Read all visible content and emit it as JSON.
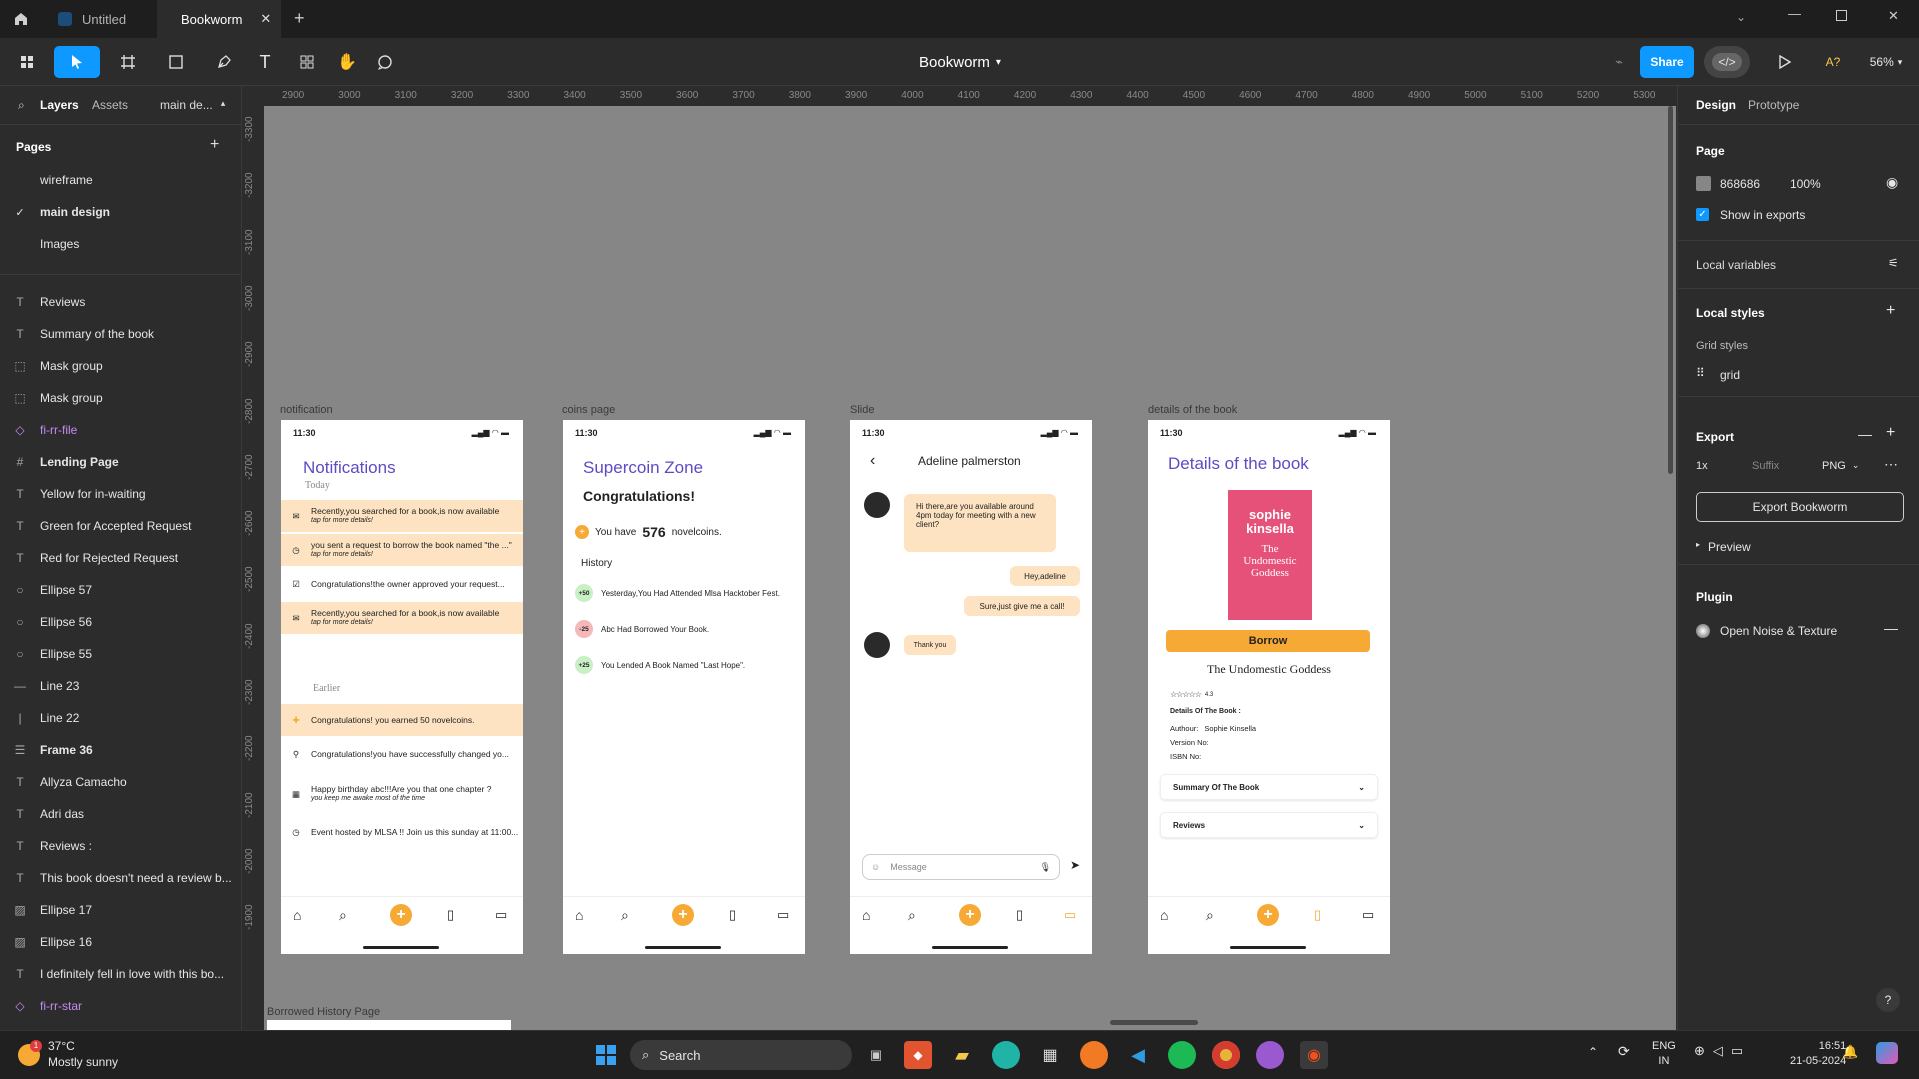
{
  "tabs": [
    {
      "label": "Untitled",
      "active": false
    },
    {
      "label": "Bookworm",
      "active": true
    }
  ],
  "toolbar": {
    "file_title": "Bookworm",
    "share_label": "Share",
    "zoom": "56%",
    "accessibility": "A?"
  },
  "left_panel": {
    "tab_layers": "Layers",
    "tab_assets": "Assets",
    "page_dropdown": "main de...",
    "pages_header": "Pages",
    "pages": [
      "wireframe",
      "main design",
      "Images"
    ],
    "current_page": "main design",
    "layers": [
      {
        "icon": "text-icon",
        "glyph": "T",
        "label": "Reviews"
      },
      {
        "icon": "text-icon",
        "glyph": "T",
        "label": "Summary of the book"
      },
      {
        "icon": "mask-icon",
        "glyph": "⬚",
        "label": "Mask group"
      },
      {
        "icon": "mask-icon",
        "glyph": "⬚",
        "label": "Mask group"
      },
      {
        "icon": "component-icon",
        "glyph": "◇",
        "label": "fi-rr-file",
        "purple": true
      },
      {
        "icon": "frame-icon",
        "glyph": "#",
        "label": "Lending Page",
        "bold": true
      },
      {
        "icon": "text-icon",
        "glyph": "T",
        "label": "Yellow for in-waiting"
      },
      {
        "icon": "text-icon",
        "glyph": "T",
        "label": "Green for Accepted Request"
      },
      {
        "icon": "text-icon",
        "glyph": "T",
        "label": "Red for Rejected Request"
      },
      {
        "icon": "ellipse-icon",
        "glyph": "○",
        "label": "Ellipse 57"
      },
      {
        "icon": "ellipse-icon",
        "glyph": "○",
        "label": "Ellipse 56"
      },
      {
        "icon": "ellipse-icon",
        "glyph": "○",
        "label": "Ellipse 55"
      },
      {
        "icon": "line-icon",
        "glyph": "—",
        "label": "Line 23"
      },
      {
        "icon": "line-icon",
        "glyph": "|",
        "label": "Line 22"
      },
      {
        "icon": "autolayout-icon",
        "glyph": "☰",
        "label": "Frame 36",
        "bold": true
      },
      {
        "icon": "text-icon",
        "glyph": "T",
        "label": "Allyza Camacho"
      },
      {
        "icon": "text-icon",
        "glyph": "T",
        "label": "Adri das"
      },
      {
        "icon": "text-icon",
        "glyph": "T",
        "label": "Reviews :"
      },
      {
        "icon": "text-icon",
        "glyph": "T",
        "label": "This book doesn't need a review b..."
      },
      {
        "icon": "image-icon",
        "glyph": "▨",
        "label": "Ellipse 17"
      },
      {
        "icon": "image-icon",
        "glyph": "▨",
        "label": "Ellipse 16"
      },
      {
        "icon": "text-icon",
        "glyph": "T",
        "label": "I definitely fell in love with this bo..."
      },
      {
        "icon": "component-icon",
        "glyph": "◇",
        "label": "fi-rr-star",
        "purple": true
      },
      {
        "icon": "component-icon",
        "glyph": "◇",
        "label": "fi-rr-star",
        "purple": true
      }
    ]
  },
  "rulers": {
    "top": [
      "2900",
      "3000",
      "3100",
      "3200",
      "3300",
      "3400",
      "3500",
      "3600",
      "3700",
      "3800",
      "3900",
      "4000",
      "4100",
      "4200",
      "4300",
      "4400",
      "4500",
      "4600",
      "4700",
      "4800",
      "4900",
      "5000",
      "5100",
      "5200",
      "5300"
    ],
    "left": [
      "-3300",
      "-3200",
      "-3100",
      "-3000",
      "-2900",
      "-2800",
      "-2700",
      "-2600",
      "-2500",
      "-2400",
      "-2300",
      "-2200",
      "-2100",
      "-2000",
      "-1900"
    ]
  },
  "canvas": {
    "frame_labels": [
      "notification",
      "coins page",
      "Slide",
      "details of the book",
      "Borrowed History Page"
    ],
    "status_time": "11:30",
    "notifications": {
      "title": "Notifications",
      "today": "Today",
      "earlier": "Earlier",
      "items": [
        {
          "icon": "mail-icon",
          "text": "Recently,you searched for a book,is now available",
          "sub": "tap for more details!",
          "highlight": true
        },
        {
          "icon": "clock-icon",
          "text": "you sent a request to borrow the book named \"the ...\"",
          "sub": "tap for more details!",
          "highlight": true
        },
        {
          "icon": "check-icon",
          "text": "Congratulations!the owner approved your request...",
          "sub": "",
          "highlight": false
        },
        {
          "icon": "mail-icon",
          "text": "Recently,you searched for a book,is now available",
          "sub": "tap for more details!",
          "highlight": true
        },
        {
          "icon": "coin-icon",
          "text": "Congratulations! you earned 50 novelcoins.",
          "sub": "",
          "highlight": true
        },
        {
          "icon": "link-icon",
          "text": "Congratulations!you have successfully changed yo...",
          "sub": "",
          "highlight": false
        },
        {
          "icon": "calendar-icon",
          "text": "Happy birthday abc!!!Are you that one chapter ?",
          "sub": "you keep me awake most of the time",
          "highlight": false
        },
        {
          "icon": "clock-icon",
          "text": "Event hosted by MLSA !! Join us this sunday at 11:00...",
          "sub": "",
          "highlight": false
        }
      ]
    },
    "coins": {
      "title": "Supercoin Zone",
      "congrats": "Congratulations!",
      "have_pre": "You have",
      "amount": "576",
      "have_post": "novelcoins.",
      "history": "History",
      "entries": [
        {
          "badge": "+50",
          "color": "#c9efc4",
          "text": "Yesterday,You Had Attended Mlsa Hacktober Fest."
        },
        {
          "badge": "-25",
          "color": "#f5b8b8",
          "text": "Abc Had Borrowed Your Book."
        },
        {
          "badge": "+25",
          "color": "#c9efc4",
          "text": "You Lended A Book Named \"Last Hope\"."
        }
      ]
    },
    "chat": {
      "name": "Adeline palmerston",
      "msg1": "Hi there,are you available around 4pm today for meeting with a new client?",
      "msg2": "Hey,adeline",
      "msg3": "Sure,just give me a call!",
      "msg4": "Thank you",
      "placeholder": "Message"
    },
    "details": {
      "title": "Details of the book",
      "cover_author": "sophie kinsella",
      "cover_title": "The Undomestic Goddess",
      "borrow": "Borrow",
      "book_title": "The Undomestic Goddess",
      "rating": "4.3",
      "section": "Details Of The Book :",
      "author_label": "Authour:",
      "author": "Sophie Kinsella",
      "version": "Version No:",
      "isbn": "ISBN No:",
      "summary": "Summary Of The Book",
      "reviews": "Reviews"
    }
  },
  "right_panel": {
    "tab_design": "Design",
    "tab_prototype": "Prototype",
    "page_header": "Page",
    "page_color": "868686",
    "page_opacity": "100%",
    "show_exports": "Show in exports",
    "local_variables": "Local variables",
    "local_styles": "Local styles",
    "grid_styles": "Grid styles",
    "grid": "grid",
    "export_header": "Export",
    "export_scale": "1x",
    "export_suffix": "Suffix",
    "export_format": "PNG",
    "export_button": "Export Bookworm",
    "preview": "Preview",
    "plugin_header": "Plugin",
    "plugin_name": "Open Noise & Texture"
  },
  "taskbar": {
    "temp": "37°C",
    "weather": "Mostly sunny",
    "search": "Search",
    "lang1": "ENG",
    "lang2": "IN",
    "time": "16:51",
    "date": "21-05-2024",
    "badge": "1"
  },
  "colors": {
    "accent": "#0d99ff",
    "canvas": "#868686",
    "brand_purple": "#5b4cc4",
    "highlight": "#fde3c1",
    "orange": "#f7a935"
  }
}
